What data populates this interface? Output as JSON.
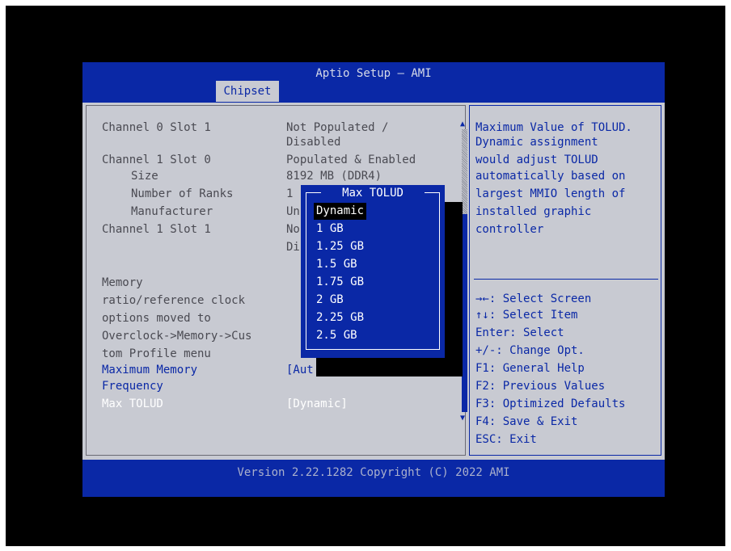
{
  "app": {
    "title": "Aptio Setup – AMI",
    "tab": "Chipset"
  },
  "left_items": {
    "ch0s1_label": "Channel 0 Slot 1",
    "ch0s1_value1": "Not Populated /",
    "ch0s1_value2": "Disabled",
    "ch1s0_label": "Channel 1 Slot 0",
    "ch1s0_value": "Populated & Enabled",
    "size_label": "Size",
    "size_value": "8192 MB (DDR4)",
    "ranks_label": "Number of Ranks",
    "ranks_value": "1",
    "manufacturer_label": "Manufacturer",
    "manufacturer_value": "Un",
    "ch1s1_label": "Channel 1 Slot 1",
    "ch1s1_value1": "No",
    "ch1s1_value2": "Di",
    "note_line1": "Memory",
    "note_line2": "ratio/reference clock",
    "note_line3": "options moved to",
    "note_line4": "Overclock->Memory->Cus",
    "note_line5": "tom Profile menu",
    "max_mem_label1": "Maximum Memory",
    "max_mem_label2": "Frequency",
    "max_mem_value": "[Aut",
    "tolud_label": "Max TOLUD",
    "tolud_value": "[Dynamic]"
  },
  "help": {
    "line1": "Maximum Value of TOLUD.",
    "line2": "Dynamic assignment",
    "line3": "would adjust TOLUD",
    "line4": "automatically based on",
    "line5": "largest MMIO length of",
    "line6": "installed graphic",
    "line7": "controller"
  },
  "keys": [
    "→←: Select Screen",
    "↑↓: Select Item",
    "Enter: Select",
    "+/-: Change Opt.",
    "F1: General Help",
    "F2: Previous Values",
    "F3: Optimized Defaults",
    "F4: Save & Exit",
    "ESC: Exit"
  ],
  "popup": {
    "title": "Max TOLUD",
    "options": [
      "Dynamic",
      "1 GB",
      "1.25 GB",
      "1.5 GB",
      "1.75 GB",
      "2 GB",
      "2.25 GB",
      "2.5 GB"
    ],
    "selected": "Dynamic"
  },
  "footer": "Version 2.22.1282 Copyright (C) 2022 AMI",
  "colors": {
    "bios_blue": "#0a28a6",
    "panel_gray": "#c8cad2",
    "text_gray": "#4a4a52"
  }
}
